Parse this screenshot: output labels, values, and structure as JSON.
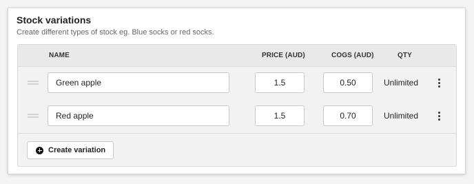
{
  "section": {
    "title": "Stock variations",
    "subtitle": "Create different types of stock eg. Blue socks or red socks."
  },
  "table": {
    "headers": {
      "name": "NAME",
      "price": "PRICE (AUD)",
      "cogs": "COGS (AUD)",
      "qty": "QTY"
    },
    "rows": [
      {
        "name": "Green apple",
        "price": "1.5",
        "cogs": "0.50",
        "qty": "Unlimited"
      },
      {
        "name": "Red apple",
        "price": "1.5",
        "cogs": "0.70",
        "qty": "Unlimited"
      }
    ]
  },
  "actions": {
    "create_label": "Create variation"
  },
  "icons": {
    "drag": "drag-handle-icon",
    "more": "more-vertical-icon",
    "add": "plus-circle-icon"
  }
}
